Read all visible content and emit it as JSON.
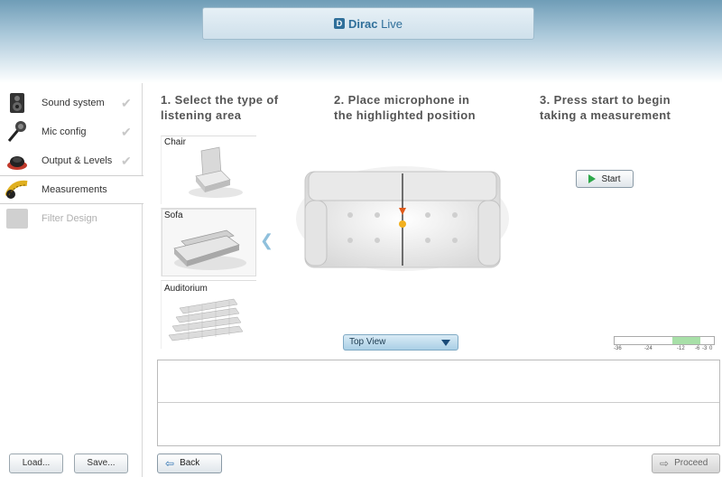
{
  "brand": {
    "logo_glyph": "D",
    "name_bold": "Dirac",
    "name_light": " Live"
  },
  "sidebar": {
    "items": [
      {
        "label": "Sound system",
        "icon": "speaker-icon",
        "done": true,
        "state": "normal"
      },
      {
        "label": "Mic config",
        "icon": "microphone-icon",
        "done": true,
        "state": "normal"
      },
      {
        "label": "Output & Levels",
        "icon": "output-levels-icon",
        "done": true,
        "state": "normal"
      },
      {
        "label": "Measurements",
        "icon": "tape-measure-icon",
        "done": false,
        "state": "active"
      },
      {
        "label": "Filter Design",
        "icon": "filter-icon",
        "done": false,
        "state": "disabled"
      }
    ],
    "check_glyph": "✔",
    "load_label": "Load...",
    "save_label": "Save..."
  },
  "steps": {
    "step1_line1": "1. Select the type of",
    "step1_line2": "listening area",
    "step2_line1": "2. Place microphone in",
    "step2_line2": "the highlighted position",
    "step3_line1": "3. Press start to begin",
    "step3_line2": "taking a measurement"
  },
  "areas": [
    {
      "label": "Chair",
      "selected": false
    },
    {
      "label": "Sofa",
      "selected": true
    },
    {
      "label": "Auditorium",
      "selected": false
    }
  ],
  "collapse_arrow": "❮",
  "start_label": "Start",
  "view_select": {
    "value": "Top View"
  },
  "level_meter": {
    "ticks": [
      "-36",
      "-24",
      "-12",
      "-6",
      "-3",
      "0"
    ],
    "green_band_db": [
      -15,
      -5
    ]
  },
  "back_label": "Back",
  "proceed_label": "Proceed",
  "colors": {
    "accent": "#2f6f9a",
    "start_green": "#2ea84a",
    "meter_green": "#a8e0a8",
    "mic_marker": "#e05a1a",
    "mic_position": "#f2b01e"
  }
}
